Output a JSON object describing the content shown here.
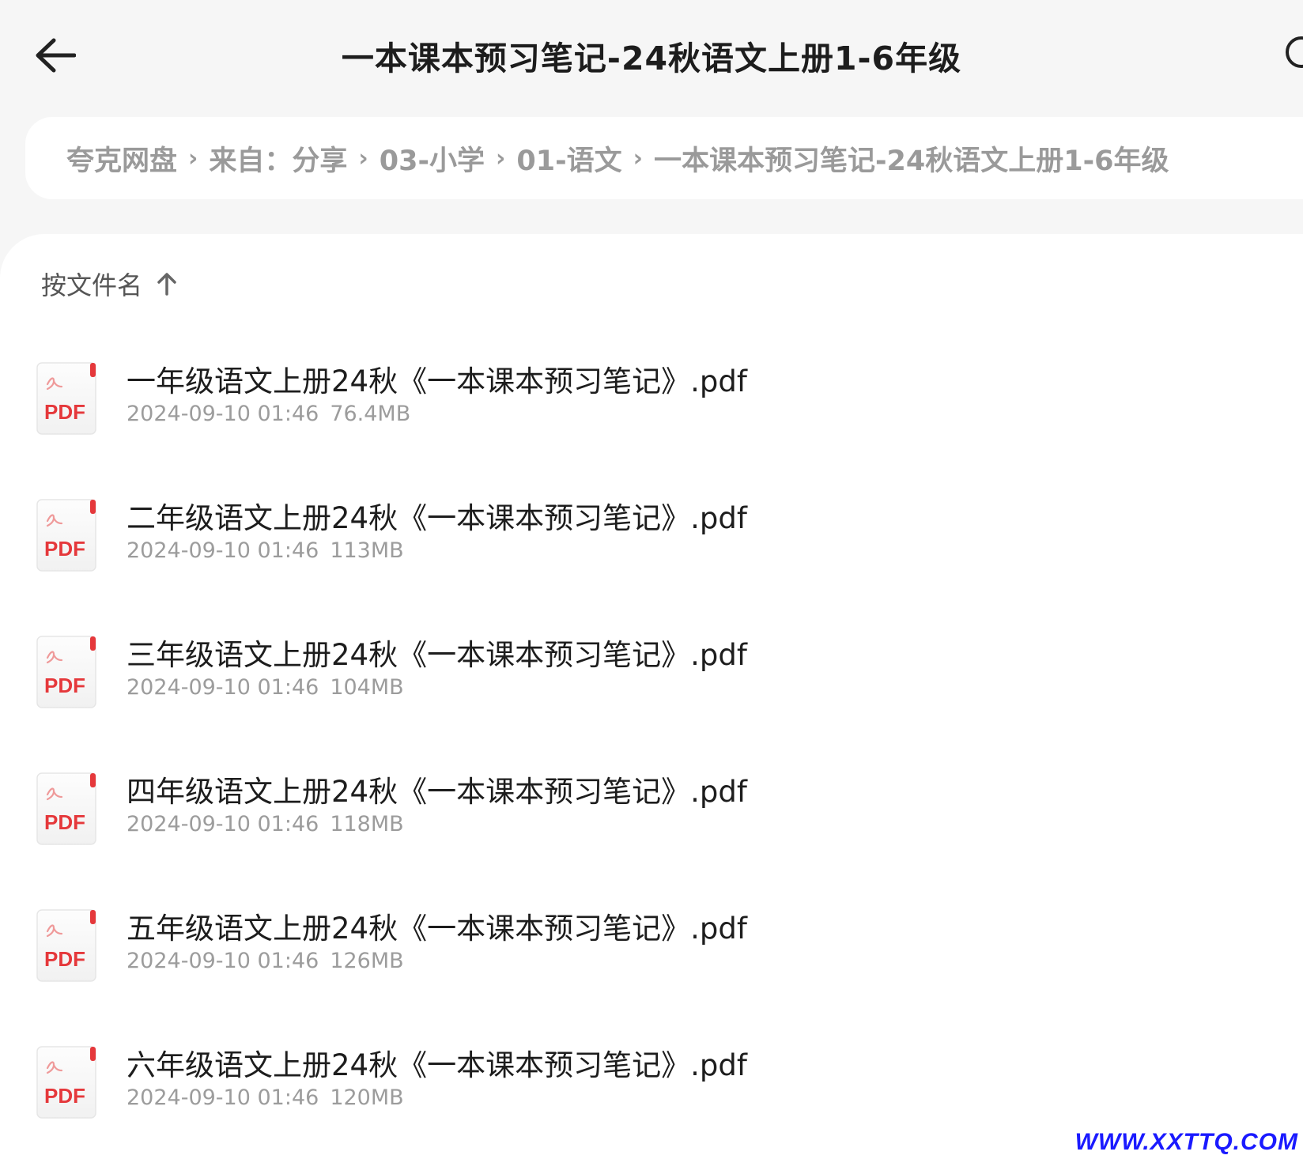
{
  "header": {
    "title": "一本课本预习笔记-24秋语文上册1-6年级"
  },
  "breadcrumb": [
    "夸克网盘",
    "来自：分享",
    "03-小学",
    "01-语文",
    "一本课本预习笔记-24秋语文上册1-6年级"
  ],
  "sort": {
    "label": "按文件名"
  },
  "files": [
    {
      "name": "一年级语文上册24秋《一本课本预习笔记》.pdf",
      "date": "2024-09-10 01:46",
      "size": "76.4MB",
      "icon_label": "PDF"
    },
    {
      "name": "二年级语文上册24秋《一本课本预习笔记》.pdf",
      "date": "2024-09-10 01:46",
      "size": "113MB",
      "icon_label": "PDF"
    },
    {
      "name": "三年级语文上册24秋《一本课本预习笔记》.pdf",
      "date": "2024-09-10 01:46",
      "size": "104MB",
      "icon_label": "PDF"
    },
    {
      "name": "四年级语文上册24秋《一本课本预习笔记》.pdf",
      "date": "2024-09-10 01:46",
      "size": "118MB",
      "icon_label": "PDF"
    },
    {
      "name": "五年级语文上册24秋《一本课本预习笔记》.pdf",
      "date": "2024-09-10 01:46",
      "size": "126MB",
      "icon_label": "PDF"
    },
    {
      "name": "六年级语文上册24秋《一本课本预习笔记》.pdf",
      "date": "2024-09-10 01:46",
      "size": "120MB",
      "icon_label": "PDF"
    }
  ],
  "watermark": "WWW.XXTTQ.COM",
  "colors": {
    "pdf_red": "#e5383b",
    "meta_gray": "#9c9c9c",
    "breadcrumb_gray": "#9a9a9a",
    "watermark_blue": "#1a1aff"
  }
}
